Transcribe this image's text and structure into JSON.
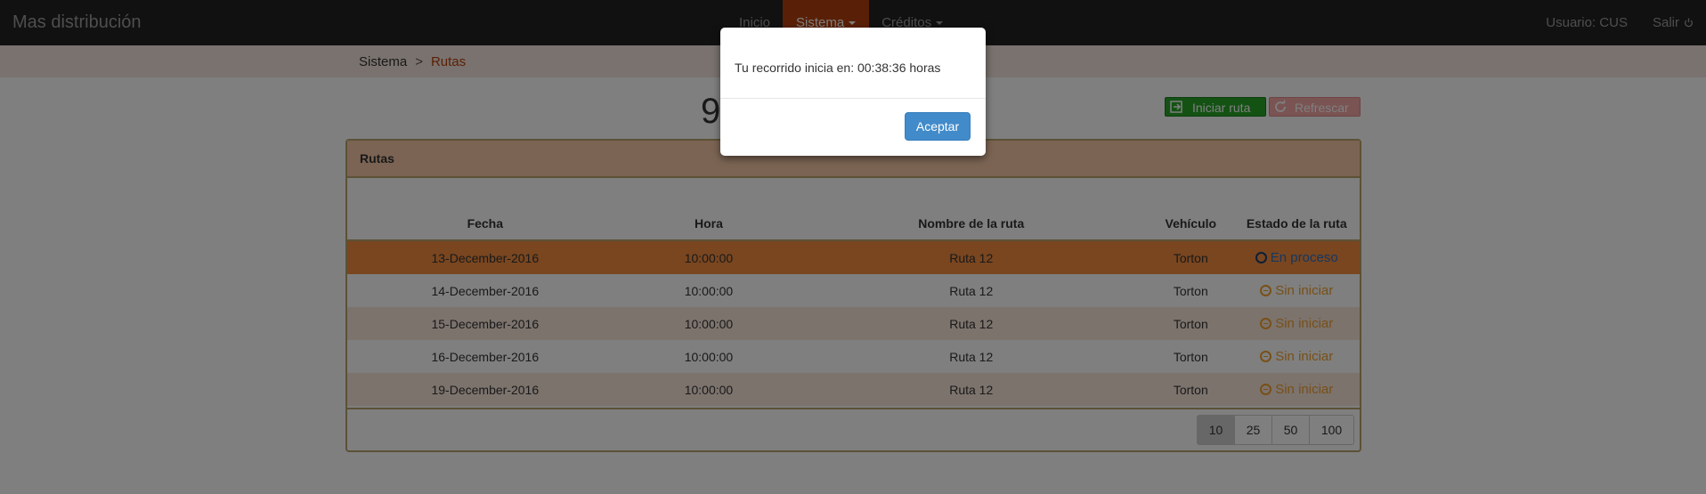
{
  "navbar": {
    "brand": "Mas distribución",
    "items": [
      {
        "label": "Inicio"
      },
      {
        "label": "Sistema"
      },
      {
        "label": "Créditos"
      }
    ],
    "user_label": "Usuario: CUS",
    "logout_label": "Salir"
  },
  "breadcrumb": {
    "root": "Sistema",
    "separator": ">",
    "current": "Rutas"
  },
  "page": {
    "title": "9",
    "start_button": "Iniciar ruta",
    "refresh_button": "Refrescar"
  },
  "panel": {
    "heading": "Rutas",
    "columns": [
      "Fecha",
      "Hora",
      "Nombre de la ruta",
      "Vehículo",
      "Estado de la ruta"
    ],
    "rows": [
      {
        "fecha": "13-December-2016",
        "hora": "10:00:00",
        "nombre": "Ruta 12",
        "vehiculo": "Torton",
        "estado": "En proceso"
      },
      {
        "fecha": "14-December-2016",
        "hora": "10:00:00",
        "nombre": "Ruta 12",
        "vehiculo": "Torton",
        "estado": "Sin iniciar"
      },
      {
        "fecha": "15-December-2016",
        "hora": "10:00:00",
        "nombre": "Ruta 12",
        "vehiculo": "Torton",
        "estado": "Sin iniciar"
      },
      {
        "fecha": "16-December-2016",
        "hora": "10:00:00",
        "nombre": "Ruta 12",
        "vehiculo": "Torton",
        "estado": "Sin iniciar"
      },
      {
        "fecha": "19-December-2016",
        "hora": "10:00:00",
        "nombre": "Ruta 12",
        "vehiculo": "Torton",
        "estado": "Sin iniciar"
      }
    ],
    "page_sizes": [
      "10",
      "25",
      "50",
      "100"
    ],
    "selected_page_size": "10"
  },
  "modal": {
    "message": "Tu recorrido inicia en: 00:38:36 horas",
    "accept_label": "Aceptar"
  },
  "colors": {
    "accent": "#b5400f",
    "active_row": "#f28c40",
    "start_button": "#28a428",
    "refresh_button": "#f5a6a6",
    "modal_button": "#428bca"
  }
}
